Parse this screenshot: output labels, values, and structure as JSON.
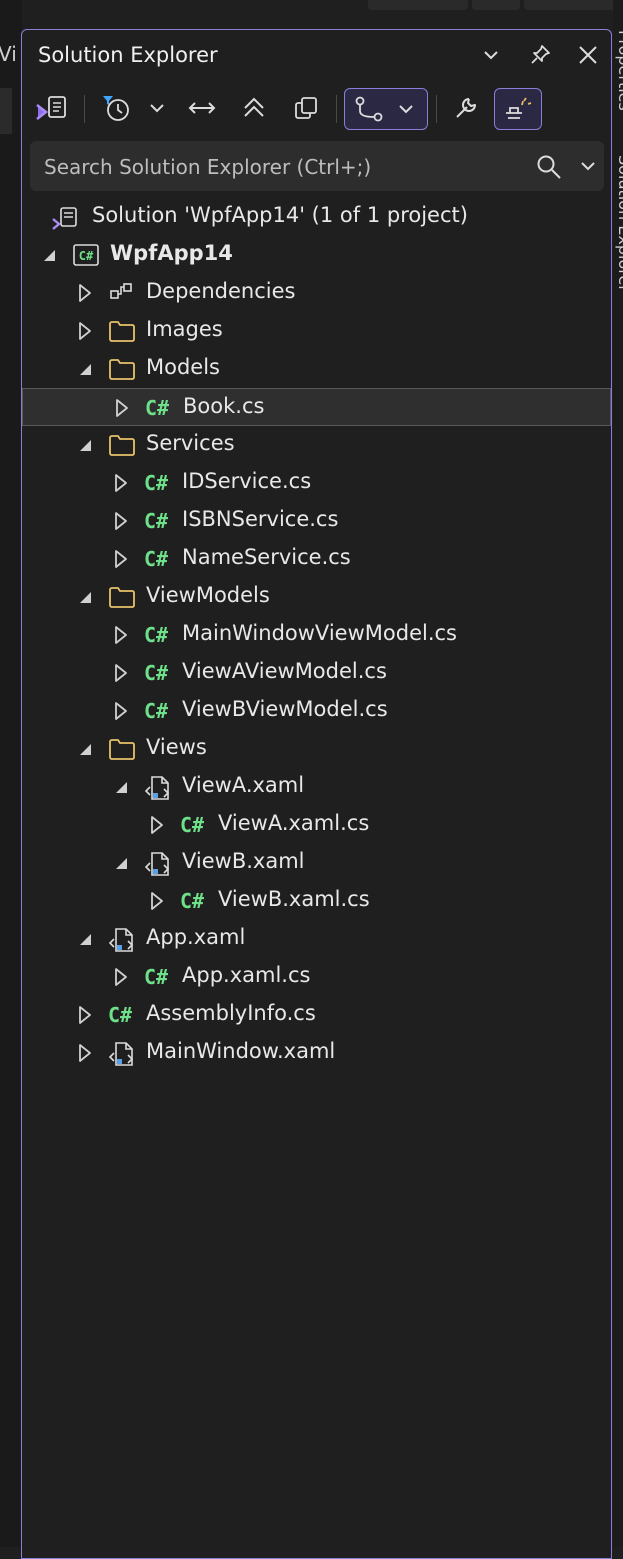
{
  "panel": {
    "title": "Solution Explorer",
    "accent": "#8a7fd8"
  },
  "left_tab_fragment": "Vi",
  "right_tabs": [
    "Properties",
    "Solution Explorer"
  ],
  "search": {
    "placeholder": "Search Solution Explorer (Ctrl+;)"
  },
  "toolbar": {
    "buttons": [
      "vs-solution-icon",
      "pending-changes-filter-icon",
      "dropdown-chevron",
      "sync-arrows-icon",
      "collapse-all-icon",
      "copy-icon",
      "git-branch-icon",
      "properties-wrench-icon",
      "preview-selected-icon"
    ]
  },
  "tree": [
    {
      "label": "Solution 'WpfApp14' (1 of 1 project)",
      "icon": "solution-icon",
      "expander": "none",
      "depth": 0,
      "bold": false
    },
    {
      "label": "WpfApp14",
      "icon": "csproj-icon",
      "expander": "expanded",
      "depth": 0,
      "bold": true
    },
    {
      "label": "Dependencies",
      "icon": "dependencies-icon",
      "expander": "collapsed",
      "depth": 1,
      "bold": false
    },
    {
      "label": "Images",
      "icon": "folder-icon",
      "expander": "collapsed",
      "depth": 1,
      "bold": false
    },
    {
      "label": "Models",
      "icon": "folder-icon",
      "expander": "expanded",
      "depth": 1,
      "bold": false
    },
    {
      "label": "Book.cs",
      "icon": "csharp-file-icon",
      "expander": "collapsed",
      "depth": 2,
      "bold": false,
      "selected": true
    },
    {
      "label": "Services",
      "icon": "folder-icon",
      "expander": "expanded",
      "depth": 1,
      "bold": false
    },
    {
      "label": "IDService.cs",
      "icon": "csharp-file-icon",
      "expander": "collapsed",
      "depth": 2,
      "bold": false
    },
    {
      "label": "ISBNService.cs",
      "icon": "csharp-file-icon",
      "expander": "collapsed",
      "depth": 2,
      "bold": false
    },
    {
      "label": "NameService.cs",
      "icon": "csharp-file-icon",
      "expander": "collapsed",
      "depth": 2,
      "bold": false
    },
    {
      "label": "ViewModels",
      "icon": "folder-icon",
      "expander": "expanded",
      "depth": 1,
      "bold": false
    },
    {
      "label": "MainWindowViewModel.cs",
      "icon": "csharp-file-icon",
      "expander": "collapsed",
      "depth": 2,
      "bold": false
    },
    {
      "label": "ViewAViewModel.cs",
      "icon": "csharp-file-icon",
      "expander": "collapsed",
      "depth": 2,
      "bold": false
    },
    {
      "label": "ViewBViewModel.cs",
      "icon": "csharp-file-icon",
      "expander": "collapsed",
      "depth": 2,
      "bold": false
    },
    {
      "label": "Views",
      "icon": "folder-icon",
      "expander": "expanded",
      "depth": 1,
      "bold": false
    },
    {
      "label": "ViewA.xaml",
      "icon": "xaml-file-icon",
      "expander": "expanded",
      "depth": 2,
      "bold": false
    },
    {
      "label": "ViewA.xaml.cs",
      "icon": "csharp-file-icon",
      "expander": "collapsed",
      "depth": 3,
      "bold": false
    },
    {
      "label": "ViewB.xaml",
      "icon": "xaml-file-icon",
      "expander": "expanded",
      "depth": 2,
      "bold": false
    },
    {
      "label": "ViewB.xaml.cs",
      "icon": "csharp-file-icon",
      "expander": "collapsed",
      "depth": 3,
      "bold": false
    },
    {
      "label": "App.xaml",
      "icon": "xaml-file-icon",
      "expander": "expanded",
      "depth": 1,
      "bold": false
    },
    {
      "label": "App.xaml.cs",
      "icon": "csharp-file-icon",
      "expander": "collapsed",
      "depth": 2,
      "bold": false
    },
    {
      "label": "AssemblyInfo.cs",
      "icon": "csharp-file-icon",
      "expander": "collapsed",
      "depth": 1,
      "bold": false
    },
    {
      "label": "MainWindow.xaml",
      "icon": "xaml-file-icon",
      "expander": "collapsed",
      "depth": 1,
      "bold": false
    }
  ],
  "colors": {
    "background": "#1f1f1f",
    "folder": "#e8c06a",
    "csharp": "#6fe08a",
    "xaml_accent": "#5aa0e6",
    "selection": "#2f2f2f"
  }
}
